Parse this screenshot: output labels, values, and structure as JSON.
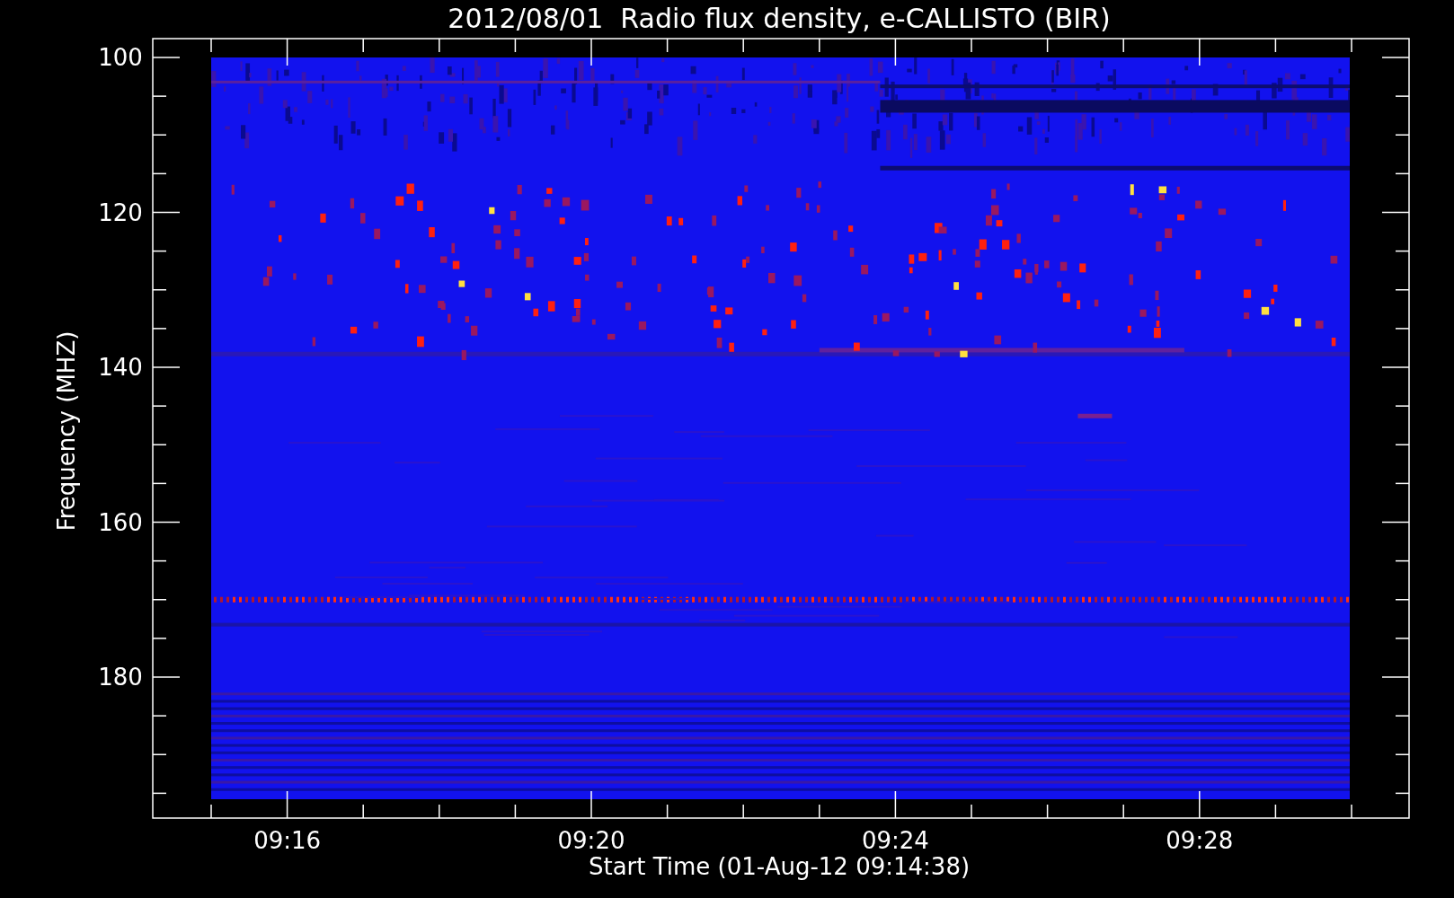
{
  "title": "2012/08/01  Radio flux density, e-CALLISTO (BIR)",
  "y_axis": {
    "label": "Frequency (MHZ)",
    "ticks": [
      "100",
      "120",
      "140",
      "160",
      "180"
    ]
  },
  "x_axis": {
    "label": "Start Time (01-Aug-12 09:14:38)",
    "ticks": [
      "09:16",
      "09:20",
      "09:24",
      "09:28"
    ]
  }
}
